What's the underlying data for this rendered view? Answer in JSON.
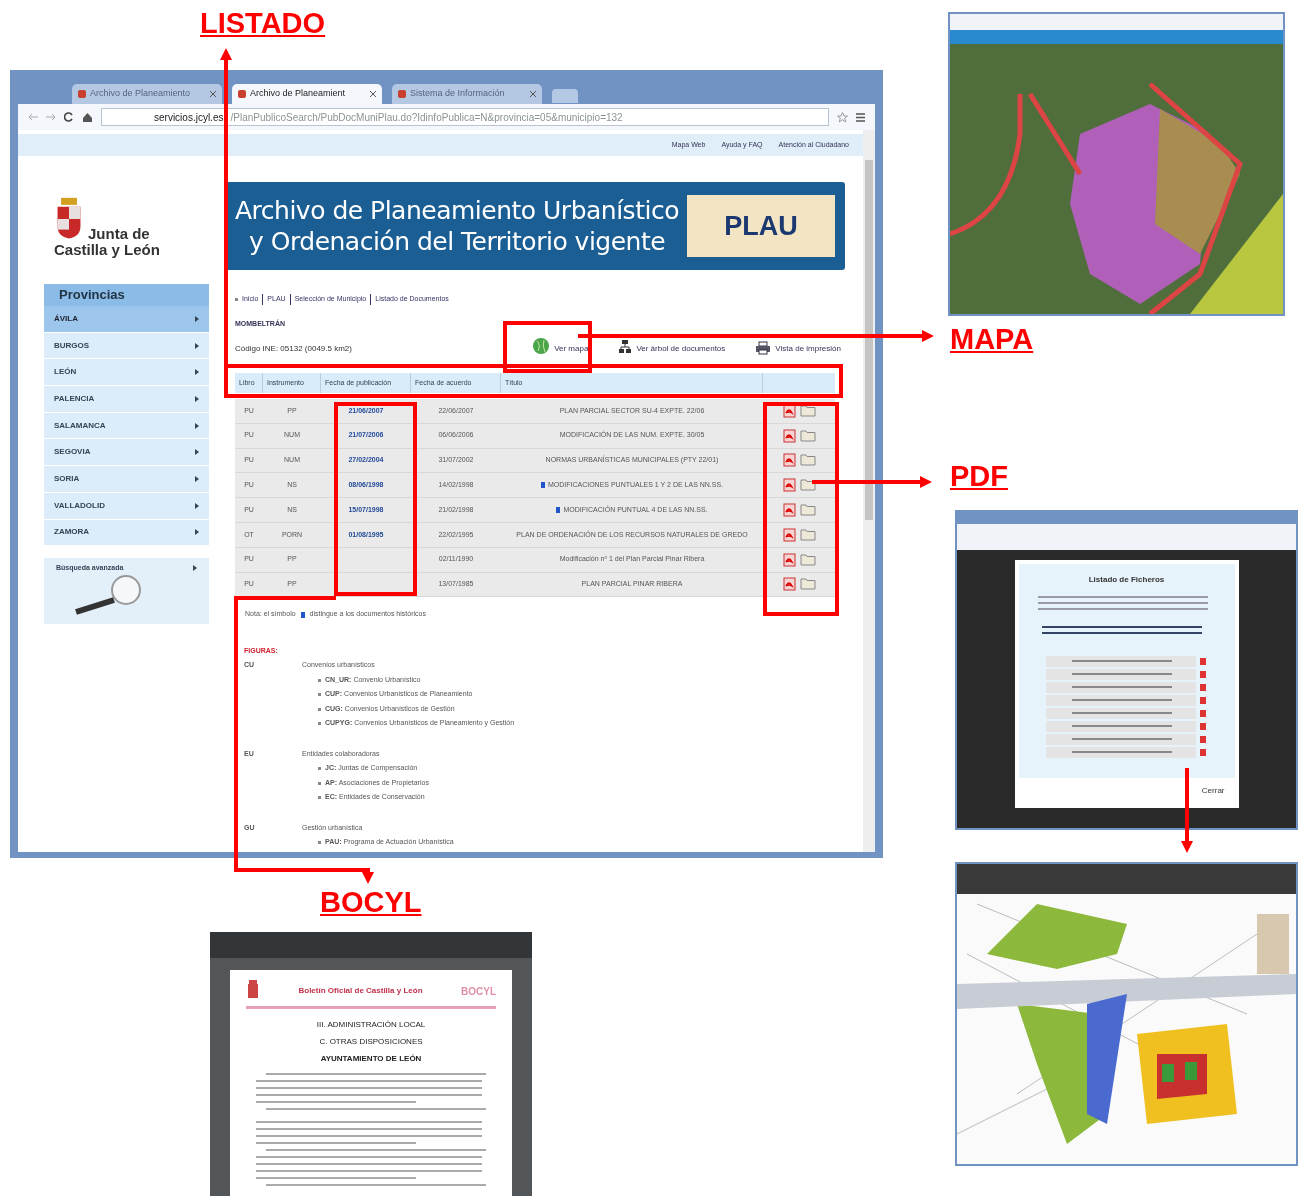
{
  "callouts": [
    "LISTADO",
    "MAPA",
    "PDF",
    "BOCYL"
  ],
  "browser": {
    "tabs": [
      {
        "title": "Archivo de Planeamiento",
        "selected": false
      },
      {
        "title": "Archivo de Planeamient",
        "selected": true
      },
      {
        "title": "Sistema de Información",
        "selected": false
      }
    ],
    "url_host": "servicios.jcyl.es",
    "url_path": "/PlanPublicoSearch/PubDocMuniPlau.do?IdinfoPublica=N&provincia=05&municipio=132",
    "top_links": [
      "Mapa Web",
      "Ayuda y FAQ",
      "Atención al Ciudadano"
    ],
    "logo": [
      "Junta de",
      "Castilla y León"
    ],
    "banner": {
      "lines": [
        "Archivo de Planeamiento Urbanístico",
        "y Ordenación del Territorio vigente"
      ],
      "badge": "PLAU"
    },
    "sidebar": {
      "heading": "Provincias",
      "items": [
        {
          "label": "ÁVILA",
          "selected": true
        },
        {
          "label": "BURGOS",
          "selected": false
        },
        {
          "label": "LEÓN",
          "selected": false
        },
        {
          "label": "PALENCIA",
          "selected": false
        },
        {
          "label": "SALAMANCA",
          "selected": false
        },
        {
          "label": "SEGOVIA",
          "selected": false
        },
        {
          "label": "SORIA",
          "selected": false
        },
        {
          "label": "VALLADOLID",
          "selected": false
        },
        {
          "label": "ZAMORA",
          "selected": false
        }
      ],
      "advanced_search": "Búsqueda avanzada"
    },
    "breadcrumb": [
      "Inicio",
      "PLAU",
      "Selección de Municipio",
      "Listado de Documentos"
    ],
    "municipality": "MOMBELTRÁN",
    "code_line": "Código INE: 05132 (0049.5 km2)",
    "actions": [
      {
        "kind": "map",
        "label": "Ver mapa"
      },
      {
        "kind": "tree",
        "label": "Ver árbol de documentos"
      },
      {
        "kind": "print",
        "label": "Vista de impresión"
      }
    ],
    "table": {
      "columns": [
        "Libro",
        "Instrumento",
        "Fecha de publicación",
        "Fecha de acuerdo",
        "Título"
      ],
      "rows": [
        {
          "libro": "PU",
          "instrumento": "PP",
          "publicacion": "21/06/2007",
          "acuerdo": "22/06/2007",
          "titulo": "PLAN PARCIAL SECTOR SU-4 EXPTE. 22/06",
          "historic": false
        },
        {
          "libro": "PU",
          "instrumento": "NUM",
          "publicacion": "21/07/2006",
          "acuerdo": "06/06/2006",
          "titulo": "MODIFICACIÓN DE LAS NUM. EXPTE. 30/05",
          "historic": false
        },
        {
          "libro": "PU",
          "instrumento": "NUM",
          "publicacion": "27/02/2004",
          "acuerdo": "31/07/2002",
          "titulo": "NORMAS URBANÍSTICAS MUNICIPALES (PTY 22/01)",
          "historic": false
        },
        {
          "libro": "PU",
          "instrumento": "NS",
          "publicacion": "08/06/1998",
          "acuerdo": "14/02/1998",
          "titulo": "MODIFICACIONES PUNTUALES 1 Y 2 DE LAS NN.SS.",
          "historic": true
        },
        {
          "libro": "PU",
          "instrumento": "NS",
          "publicacion": "15/07/1998",
          "acuerdo": "21/02/1998",
          "titulo": "MODIFICACIÓN PUNTUAL 4 DE LAS NN.SS.",
          "historic": true
        },
        {
          "libro": "OT",
          "instrumento": "PORN",
          "publicacion": "01/08/1995",
          "acuerdo": "22/02/1995",
          "titulo": "PLAN DE ORDENACIÓN DE LOS RECURSOS NATURALES DE GREDO",
          "historic": false
        },
        {
          "libro": "PU",
          "instrumento": "PP",
          "acuerdo": "02/11/1990",
          "titulo": "Modificación nº 1 del Plan Parcial Pinar Ribera",
          "historic": false
        },
        {
          "libro": "PU",
          "instrumento": "PP",
          "acuerdo": "13/07/1985",
          "titulo": "PLAN PARCIAL PINAR RIBERA",
          "historic": false
        }
      ]
    },
    "note": {
      "before": "Nota: el símbolo",
      "after": "distingue a los documentos históricos"
    },
    "figuras": {
      "heading": "FIGURAS:",
      "groups": [
        {
          "code": "CU",
          "title": "Convenios urbanísticos",
          "items": [
            {
              "abbr": "CN_UR:",
              "text": "Convenio Urbanístico"
            },
            {
              "abbr": "CUP:",
              "text": "Convenios Urbanísticos de Planeamiento"
            },
            {
              "abbr": "CUG:",
              "text": "Convenios Urbanísticos de Gestión"
            },
            {
              "abbr": "CUPYG:",
              "text": "Convenios Urbanísticos de Planeamiento y Gestión"
            }
          ]
        },
        {
          "code": "EU",
          "title": "Entidades colaboradoras",
          "items": [
            {
              "abbr": "JC:",
              "text": "Juntas de Compensación"
            },
            {
              "abbr": "AP:",
              "text": "Asociaciones de Propietarios"
            },
            {
              "abbr": "EC:",
              "text": "Entidades de Conservación"
            }
          ]
        },
        {
          "code": "GU",
          "title": "Gestión urbanística",
          "items": [
            {
              "abbr": "PAU:",
              "text": "Programa de Actuación Urbanística"
            }
          ]
        }
      ]
    }
  },
  "pdf_modal": {
    "title": "Listado de Ficheros",
    "close": "Cerrar"
  },
  "bocyl": {
    "title": "Boletín Oficial de Castilla y León",
    "logo": "BOCYL",
    "headings": [
      "III. ADMINISTRACIÓN LOCAL",
      "C. OTRAS DISPOSICIONES",
      "AYUNTAMIENTO DE LEÓN"
    ]
  }
}
